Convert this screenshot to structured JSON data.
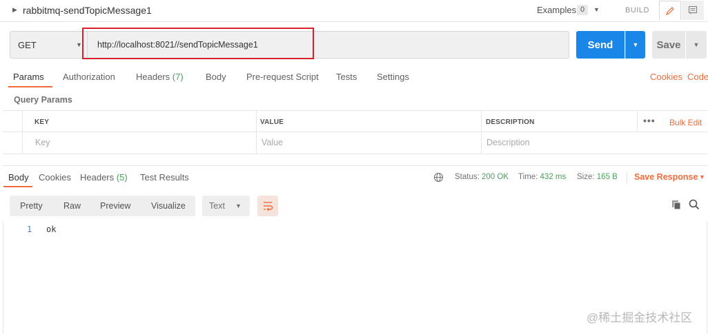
{
  "request": {
    "title": "rabbitmq-sendTopicMessage1",
    "method": "GET",
    "url": "http://localhost:8021//sendTopicMessage1"
  },
  "topbar": {
    "examples_label": "Examples",
    "examples_count": "0",
    "build_label": "BUILD"
  },
  "actions": {
    "send_label": "Send",
    "save_label": "Save"
  },
  "request_tabs": {
    "params": "Params",
    "authorization": "Authorization",
    "headers": "Headers",
    "headers_count": "(7)",
    "body": "Body",
    "prerequest": "Pre-request Script",
    "tests": "Tests",
    "settings": "Settings",
    "cookies": "Cookies",
    "code": "Code"
  },
  "query_params": {
    "title": "Query Params",
    "columns": [
      "KEY",
      "VALUE",
      "DESCRIPTION"
    ],
    "placeholders": [
      "Key",
      "Value",
      "Description"
    ],
    "bulk_edit": "Bulk Edit",
    "more": "•••"
  },
  "response": {
    "tabs": {
      "body": "Body",
      "cookies": "Cookies",
      "headers": "Headers",
      "headers_count": "(5)",
      "test_results": "Test Results"
    },
    "status_label": "Status:",
    "status_value": "200 OK",
    "time_label": "Time:",
    "time_value": "432 ms",
    "size_label": "Size:",
    "size_value": "165 B",
    "save_response": "Save Response",
    "formats": [
      "Pretty",
      "Raw",
      "Preview",
      "Visualize"
    ],
    "text_type": "Text",
    "lines": [
      {
        "number": "1",
        "text": "ok"
      }
    ]
  },
  "watermark": "@稀土掘金技术社区",
  "colors": {
    "accent": "#f26b3a",
    "send": "#1a86e8",
    "success": "#4aa05a",
    "highlight_box": "#d8202a"
  }
}
